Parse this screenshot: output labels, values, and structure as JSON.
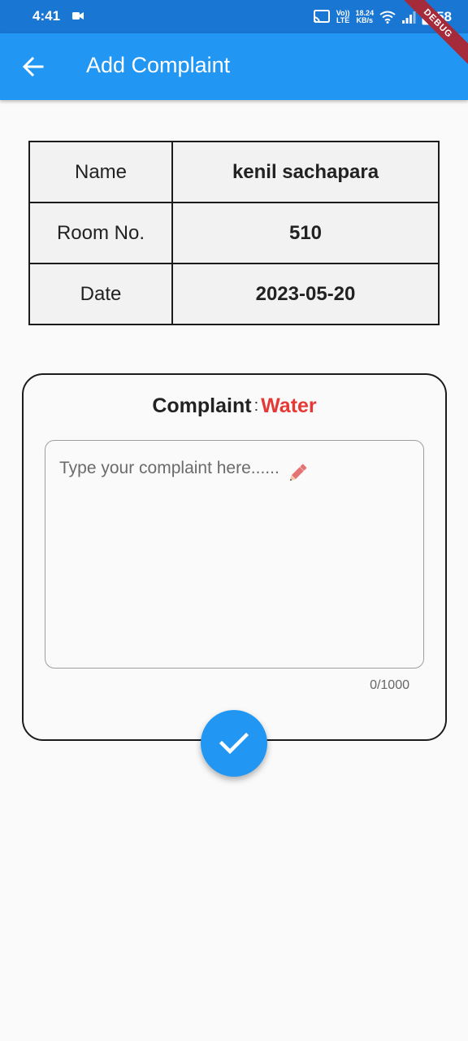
{
  "status_bar": {
    "time": "4:41",
    "network_line1": "Vo))",
    "network_line2": "LTE",
    "speed_line1": "18.24",
    "speed_line2": "KB/s",
    "battery": "58"
  },
  "debug_banner": "DEBUG",
  "app_bar": {
    "title": "Add Complaint"
  },
  "info_table": {
    "rows": [
      {
        "label": "Name",
        "value": "kenil sachapara"
      },
      {
        "label": "Room No.",
        "value": "510"
      },
      {
        "label": "Date",
        "value": "2023-05-20"
      }
    ]
  },
  "complaint": {
    "heading_label": "Complaint",
    "separator": ":",
    "type": "Water",
    "placeholder": "Type your complaint here......",
    "value": "",
    "counter": "0/1000"
  },
  "colors": {
    "primary": "#2196f3",
    "status_bar": "#1976d2",
    "accent_red": "#e53935",
    "debug_ribbon": "#a52a3a"
  },
  "icons": {
    "back": "arrow-left-icon",
    "pencil": "pencil-icon",
    "submit": "check-icon"
  }
}
